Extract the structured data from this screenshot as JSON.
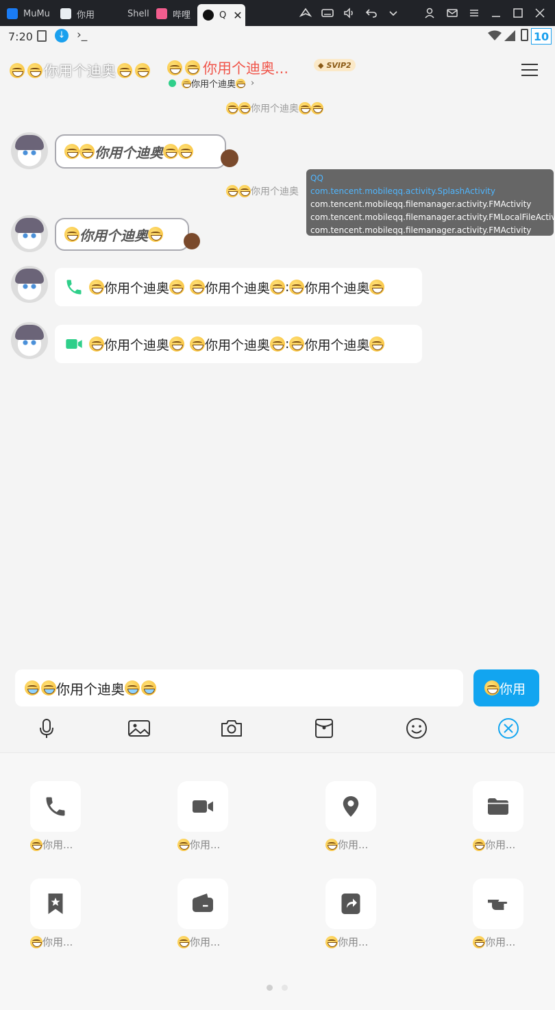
{
  "titlebar": {
    "tabs": [
      {
        "label": "MuMu",
        "icon": "mumu-icon"
      },
      {
        "label": "你用",
        "icon": "app-icon"
      },
      {
        "label": "Shell",
        "icon": "blank-icon"
      },
      {
        "label": "哔哩",
        "icon": "bilibili-icon"
      },
      {
        "label": "Q",
        "icon": "qq-penguin-icon"
      }
    ]
  },
  "statusbar": {
    "time": "7:20",
    "battery": "10"
  },
  "header": {
    "name_white": "你用个迪奥",
    "name_red": "你用个迪奥...",
    "badge": "SVIP2",
    "status": "你用个迪奥"
  },
  "messages": {
    "sys1": "你用个迪奥",
    "deco1": "你用个迪奥",
    "sys2": "你用个迪奥",
    "deco2": "你用个迪奥",
    "call1": {
      "a": "你用个迪奥",
      "b": "你用个迪奥",
      "c": "你用个迪奥"
    },
    "call2": {
      "a": "你用个迪奥",
      "b": "你用个迪奥",
      "c": "你用个迪奥"
    }
  },
  "tooltip": {
    "lines": [
      "QQ",
      "com.tencent.mobileqq.activity.SplashActivity",
      "com.tencent.mobileqq.filemanager.activity.FMActivity",
      "com.tencent.mobileqq.filemanager.activity.FMLocalFileActivity",
      "com.tencent.mobileqq.filemanager.activity.FMActivity"
    ]
  },
  "input": {
    "value": "你用个迪奥",
    "send": "你用"
  },
  "panel": {
    "items": [
      {
        "label": "你用...",
        "icon": "phone-icon"
      },
      {
        "label": "你用...",
        "icon": "video-icon"
      },
      {
        "label": "你用...",
        "icon": "location-icon"
      },
      {
        "label": "你用...",
        "icon": "folder-icon"
      },
      {
        "label": "你用...",
        "icon": "favorite-icon"
      },
      {
        "label": "你用...",
        "icon": "wallet-icon"
      },
      {
        "label": "你用...",
        "icon": "share-icon"
      },
      {
        "label": "你用...",
        "icon": "poke-icon"
      }
    ],
    "page": "1/2"
  },
  "colors": {
    "accent": "#12a5f0",
    "green": "#2fcf8a",
    "red": "#f0564b"
  }
}
